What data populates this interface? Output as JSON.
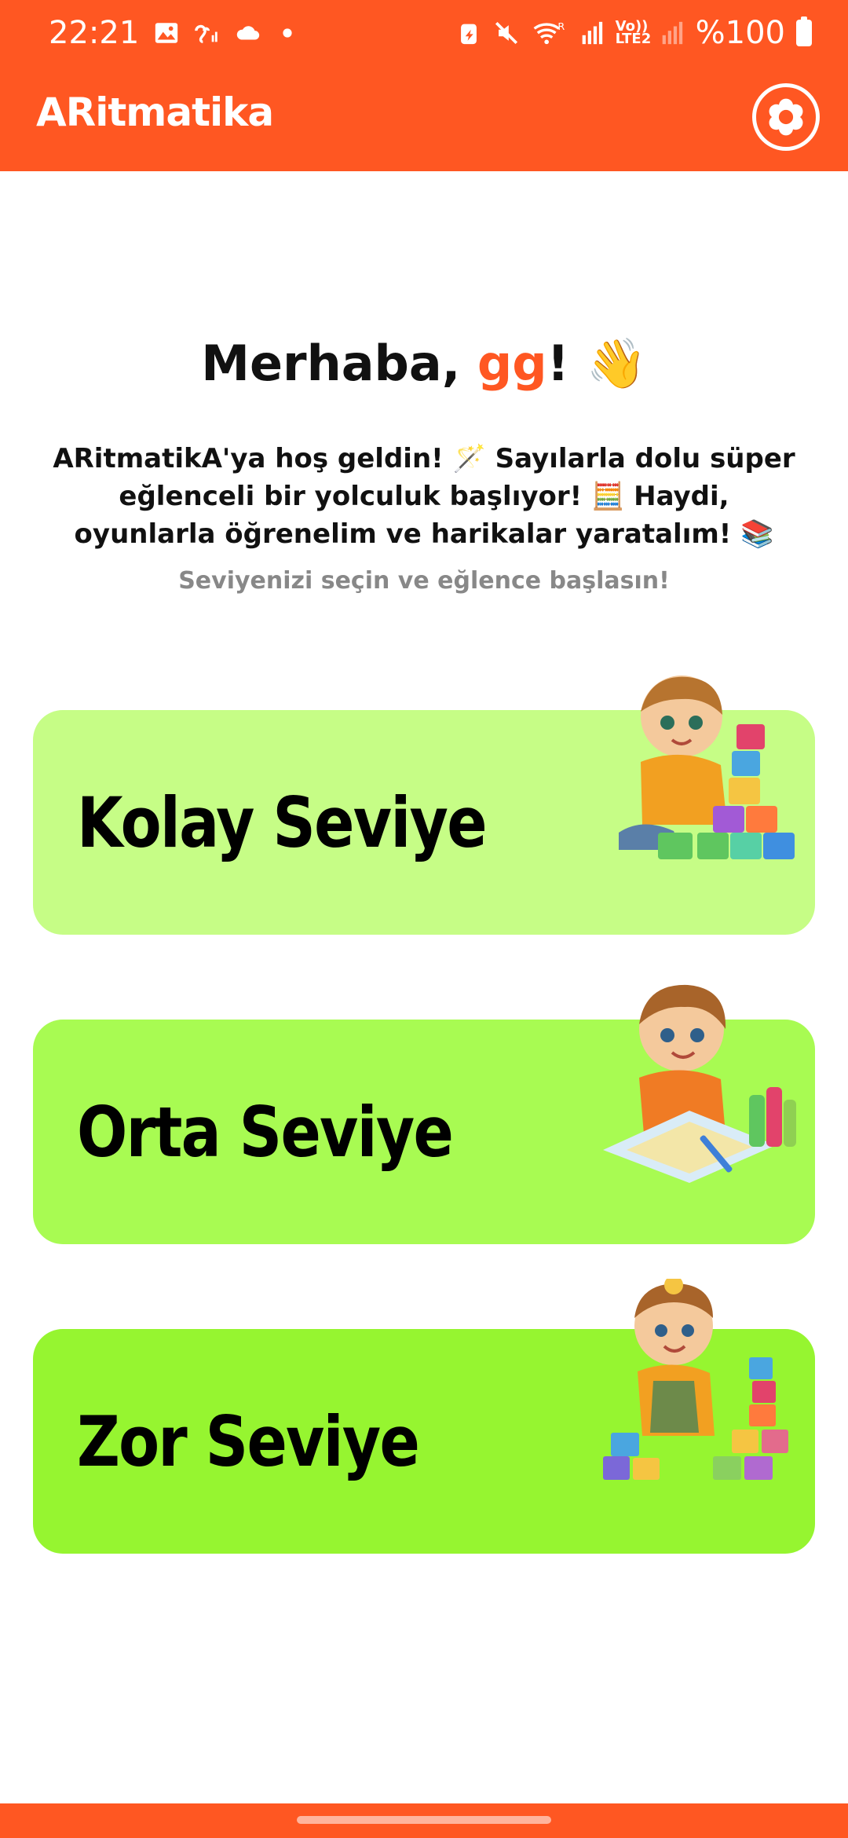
{
  "status_bar": {
    "time": "22:21",
    "volte": "Vo)) LTE2",
    "battery": "%100",
    "icons": [
      "image-icon",
      "hearing-icon",
      "cloud-icon",
      "dot-icon",
      "battery-saver-icon",
      "mute-icon",
      "wifi-icon",
      "signal-icon",
      "signal-weak-icon",
      "battery-icon"
    ]
  },
  "app_bar": {
    "title": "ARitmatika",
    "settings_icon": "settings-flower-icon"
  },
  "greeting": {
    "prefix": "Merhaba, ",
    "name": "gg",
    "suffix": "! 👋"
  },
  "welcome_text": "ARitmatikA'ya hoş geldin! 🪄 Sayılarla dolu süper eğlenceli bir yolculuk başlıyor! 🧮 Haydi, oyunlarla öğrenelim ve harikalar yaratalım! 📚",
  "prompt": "Seviyenizi seçin ve eğlence başlasın!",
  "levels": [
    {
      "label": "Kolay Seviye",
      "color": "#c6fd86",
      "illustration": "child-stacking-blocks-image"
    },
    {
      "label": "Orta Seviye",
      "color": "#a8fb52",
      "illustration": "child-drawing-image"
    },
    {
      "label": "Zor Seviye",
      "color": "#96f530",
      "illustration": "child-with-blocks-image"
    }
  ],
  "colors": {
    "brand": "#ff5722",
    "name_accent": "#ff5722",
    "prompt_gray": "#888888"
  }
}
